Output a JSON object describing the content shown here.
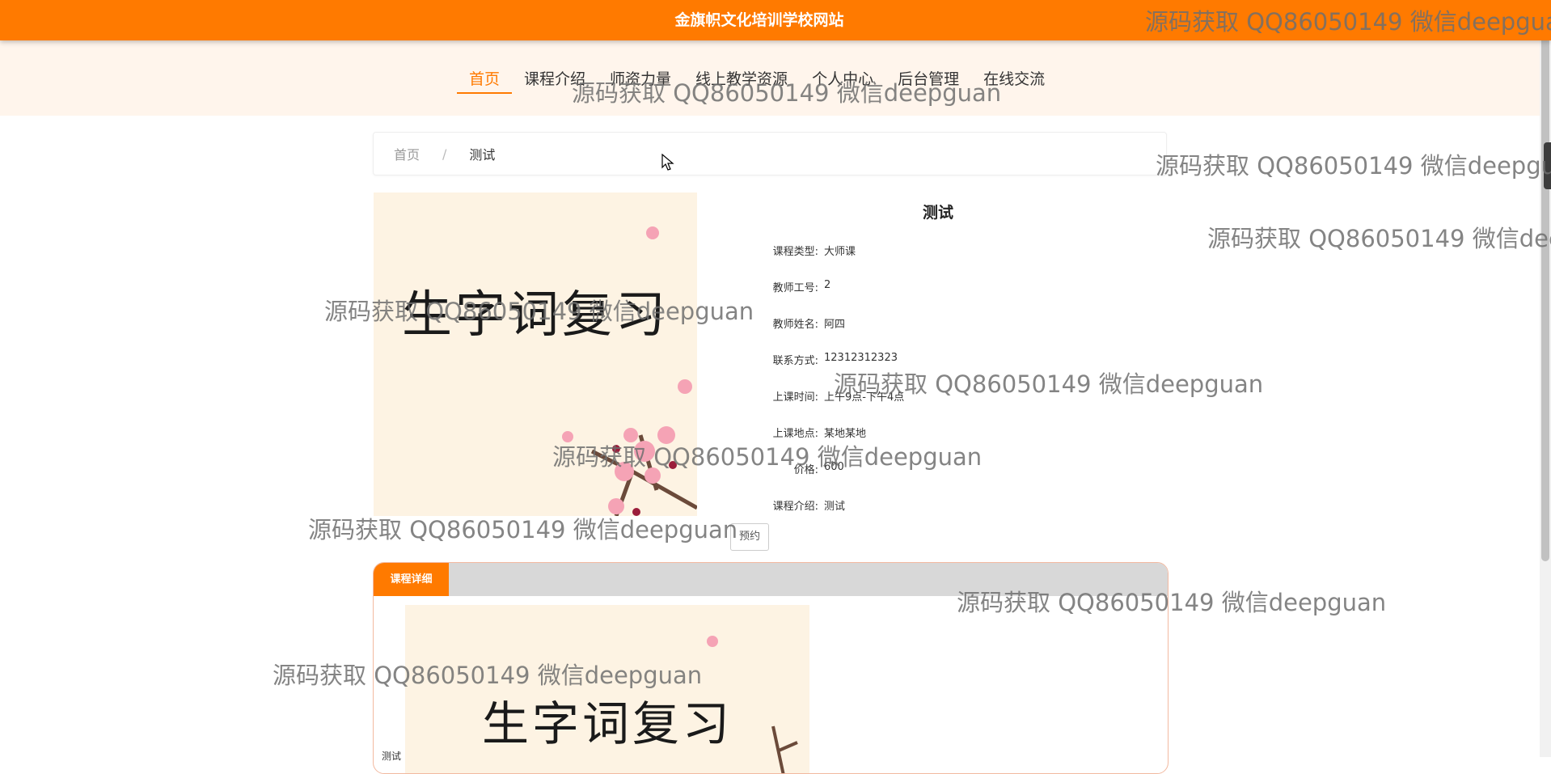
{
  "header": {
    "site_title": "金旗帜文化培训学校网站"
  },
  "nav": {
    "items": [
      {
        "label": "首页",
        "active": true
      },
      {
        "label": "课程介绍"
      },
      {
        "label": "师资力量"
      },
      {
        "label": "线上教学资源"
      },
      {
        "label": "个人中心"
      },
      {
        "label": "后台管理"
      },
      {
        "label": "在线交流"
      }
    ]
  },
  "breadcrumb": {
    "home": "首页",
    "separator": "/",
    "current": "测试"
  },
  "course": {
    "poster_text": "生字词复习",
    "title": "测试",
    "fields": [
      {
        "label": "课程类型:",
        "value": "大师课"
      },
      {
        "label": "教师工号:",
        "value": "2"
      },
      {
        "label": "教师姓名:",
        "value": "阿四"
      },
      {
        "label": "联系方式:",
        "value": "12312312323"
      },
      {
        "label": "上课时间:",
        "value": "上午9点-下午4点"
      },
      {
        "label": "上课地点:",
        "value": "某地某地"
      },
      {
        "label": "价格:",
        "value": "600"
      },
      {
        "label": "课程介绍:",
        "value": "测试"
      }
    ],
    "book_label": "预约"
  },
  "detail": {
    "tab_label": "课程详细",
    "text": "测试"
  },
  "watermark": {
    "text": "源码获取 QQ86050149 微信deepguan"
  },
  "colors": {
    "brand": "#ff7a00",
    "nav_bg": "#fff5ec",
    "poster_bg": "#fdf3e3"
  }
}
